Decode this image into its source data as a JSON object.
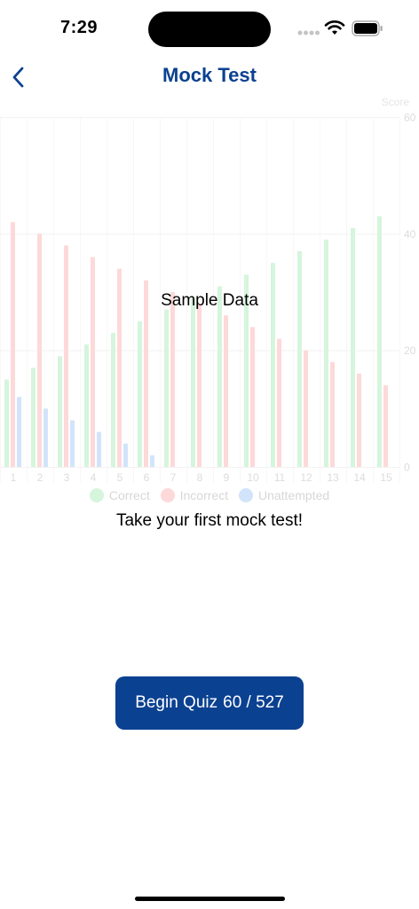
{
  "status": {
    "time": "7:29"
  },
  "nav": {
    "title": "Mock Test"
  },
  "chart_data": {
    "type": "bar",
    "categories": [
      "1",
      "2",
      "3",
      "4",
      "5",
      "6",
      "7",
      "8",
      "9",
      "10",
      "11",
      "12",
      "13",
      "14",
      "15"
    ],
    "series": [
      {
        "name": "Correct",
        "color": "#d5f5dc",
        "values": [
          15,
          17,
          19,
          21,
          23,
          25,
          27,
          29,
          31,
          33,
          35,
          37,
          39,
          41,
          43
        ]
      },
      {
        "name": "Incorrect",
        "color": "#fdd9d9",
        "values": [
          42,
          40,
          38,
          36,
          34,
          32,
          30,
          28,
          26,
          24,
          22,
          20,
          18,
          16,
          14
        ]
      },
      {
        "name": "Unattempted",
        "color": "#d2e4fb",
        "values": [
          12,
          10,
          8,
          6,
          4,
          2,
          0,
          0,
          0,
          0,
          0,
          0,
          0,
          0,
          0
        ]
      }
    ],
    "ylabel": "Score",
    "ylim": [
      0,
      60
    ],
    "yticks": [
      0,
      20,
      40,
      60
    ],
    "legend": "bottom",
    "grid": true,
    "overlay_text": "Sample Data"
  },
  "message": "Take your first mock test!",
  "begin_button": {
    "label": "Begin Quiz",
    "progress": "60 / 527"
  }
}
